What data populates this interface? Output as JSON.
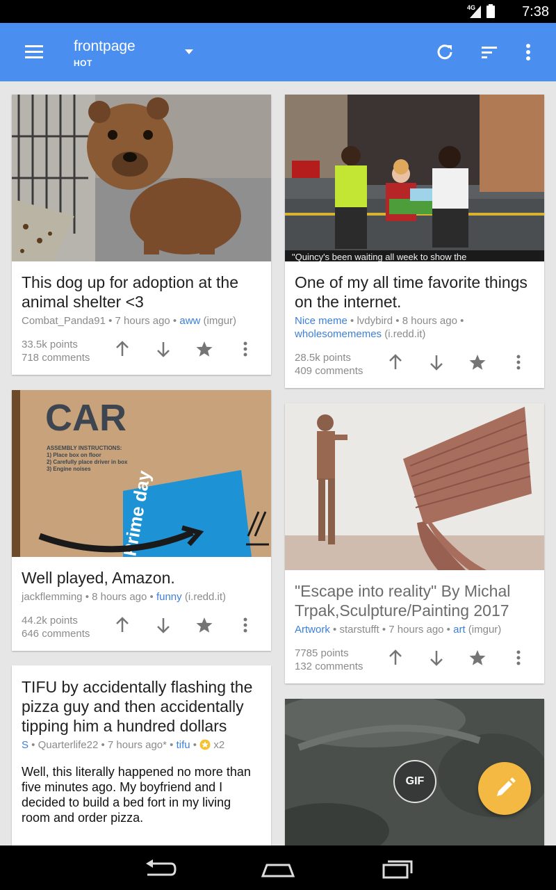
{
  "status": {
    "network": "4G",
    "time": "7:38"
  },
  "appbar": {
    "title": "frontpage",
    "subtitle": "HOT"
  },
  "posts": [
    {
      "title": "This dog up for adoption at the animal shelter <3",
      "author": "Combat_Panda91",
      "age": "7 hours ago",
      "subreddit": "aww",
      "domain": "(imgur)",
      "points": "33.5k points",
      "comments": "718 comments"
    },
    {
      "title": "One of my all time favorite things on the internet.",
      "flair": "Nice meme",
      "author": "lvdybird",
      "age": "8 hours ago",
      "subreddit": "wholesomememes",
      "domain": "(i.redd.it)",
      "points": "28.5k points",
      "comments": "409 comments",
      "caption": "\"Quincy's been waiting all week to show the"
    },
    {
      "title": "Well played, Amazon.",
      "author": "jackflemming",
      "age": "8 hours ago",
      "subreddit": "funny",
      "domain": "(i.redd.it)",
      "points": "44.2k points",
      "comments": "646 comments",
      "box_text": "CAR",
      "box_instructions": [
        "ASSEMBLY INSTRUCTIONS:",
        "1) Place box on floor",
        "2) Carefully place driver in box",
        "3) Engine noises"
      ],
      "tape_text": "Prime day"
    },
    {
      "title": "\"Escape into reality\" By Michal Trpak,Sculpture/Painting 2017",
      "flair": "Artwork",
      "author": "starstufft",
      "age": "7 hours ago",
      "subreddit": "art",
      "domain": "(imgur)",
      "points": "7785 points",
      "comments": "132 comments"
    },
    {
      "title": "TIFU by accidentally flashing the pizza guy and then accidentally tipping him a hundred dollars",
      "tag": "S",
      "author": "Quarterlife22",
      "age": "7 hours ago*",
      "subreddit": "tifu",
      "gilded": "x2",
      "body": "Well, this literally happened no more than five minutes ago. My boyfriend and I decided to build a bed fort in my living room and order pizza."
    },
    {
      "gif_label": "GIF"
    }
  ],
  "colors": {
    "appbar": "#4a8ef0",
    "accent": "#3b7fd8",
    "fab": "#f4b942",
    "gold": "#f2c230"
  },
  "icons": [
    "menu-icon",
    "dropdown-icon",
    "refresh-icon",
    "sort-icon",
    "overflow-icon",
    "upvote-icon",
    "downvote-icon",
    "star-icon",
    "more-icon",
    "pencil-icon",
    "back-icon",
    "home-icon",
    "recents-icon"
  ]
}
